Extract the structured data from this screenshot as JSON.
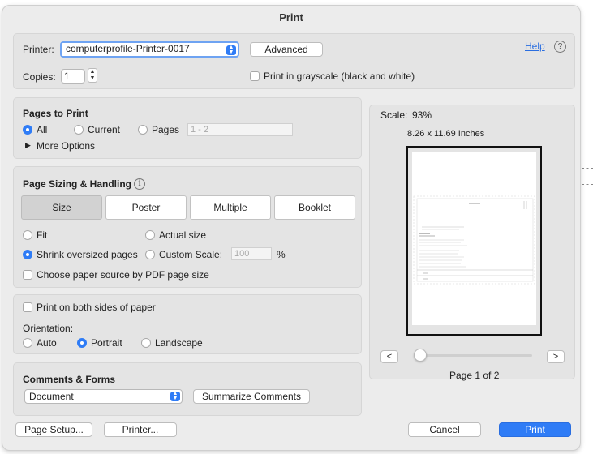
{
  "dialog": {
    "title": "Print"
  },
  "printer": {
    "label": "Printer:",
    "value": "computerprofile-Printer-0017",
    "advanced_label": "Advanced",
    "help_label": "Help",
    "help_icon": "?"
  },
  "copies": {
    "label": "Copies:",
    "value": "1",
    "grayscale_label": "Print in grayscale (black and white)",
    "grayscale_checked": false
  },
  "pages_to_print": {
    "title": "Pages to Print",
    "options": [
      "All",
      "Current",
      "Pages"
    ],
    "selected": "All",
    "range_placeholder": "1 - 2",
    "more_options_label": "More Options"
  },
  "sizing": {
    "title": "Page Sizing & Handling",
    "info_icon": "i",
    "tabs": [
      "Size",
      "Poster",
      "Multiple",
      "Booklet"
    ],
    "selected_tab": "Size",
    "fit_label": "Fit",
    "actual_size_label": "Actual size",
    "shrink_label": "Shrink oversized pages",
    "custom_scale_label": "Custom Scale:",
    "custom_scale_value": "100",
    "percent": "%",
    "selected_option": "Shrink oversized pages",
    "paper_source_label": "Choose paper source by PDF page size",
    "paper_source_checked": false
  },
  "orientation": {
    "both_sides_label": "Print on both sides of paper",
    "both_sides_checked": false,
    "label": "Orientation:",
    "options": [
      "Auto",
      "Portrait",
      "Landscape"
    ],
    "selected": "Portrait"
  },
  "comments": {
    "title": "Comments & Forms",
    "value": "Document",
    "summarize_label": "Summarize Comments"
  },
  "preview": {
    "scale_label": "Scale:",
    "scale_value": "93%",
    "dimensions": "8.26 x 11.69 Inches",
    "prev_label": "<",
    "next_label": ">",
    "page_indicator": "Page 1 of 2",
    "current_page": 1,
    "total_pages": 2
  },
  "footer": {
    "page_setup_label": "Page Setup...",
    "printer_label": "Printer...",
    "cancel_label": "Cancel",
    "print_label": "Print"
  },
  "colors": {
    "accent": "#2f7cf6",
    "dialog_bg": "#ececec",
    "panel_bg": "#e4e4e4"
  }
}
